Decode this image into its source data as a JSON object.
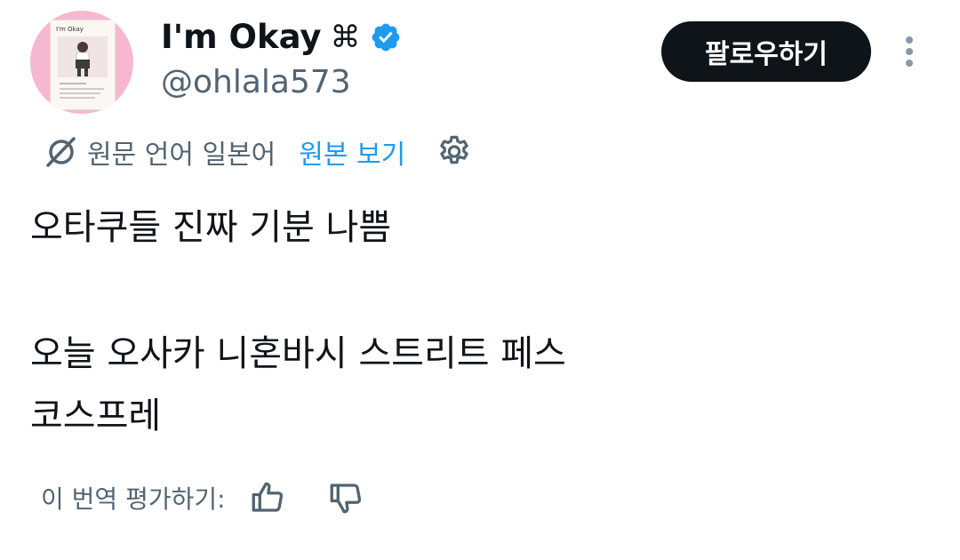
{
  "user": {
    "display_name": "I'm Okay",
    "name_symbol": "⌘",
    "handle": "@ohlala573",
    "verified_color": "#1d9bf0"
  },
  "avatar": {
    "card_title": "I'm Okay"
  },
  "follow_button": {
    "label": "팔로우하기"
  },
  "translation": {
    "source_language_text": "원문 언어 일본어",
    "view_original_label": "원본 보기",
    "link_color": "#1d9bf0"
  },
  "tweet": {
    "lines": [
      "오타쿠들 진짜 기분 나쁨",
      "",
      "오늘 오사카 니혼바시 스트리트 페스",
      "코스프레"
    ]
  },
  "rating": {
    "prompt": "이 번역 평가하기:"
  },
  "icons": {
    "translate": "translate-icon",
    "verified": "verified-badge-icon",
    "more": "more-vertical-icon",
    "settings": "gear-icon",
    "thumbs_up": "thumbs-up-icon",
    "thumbs_down": "thumbs-down-icon"
  }
}
